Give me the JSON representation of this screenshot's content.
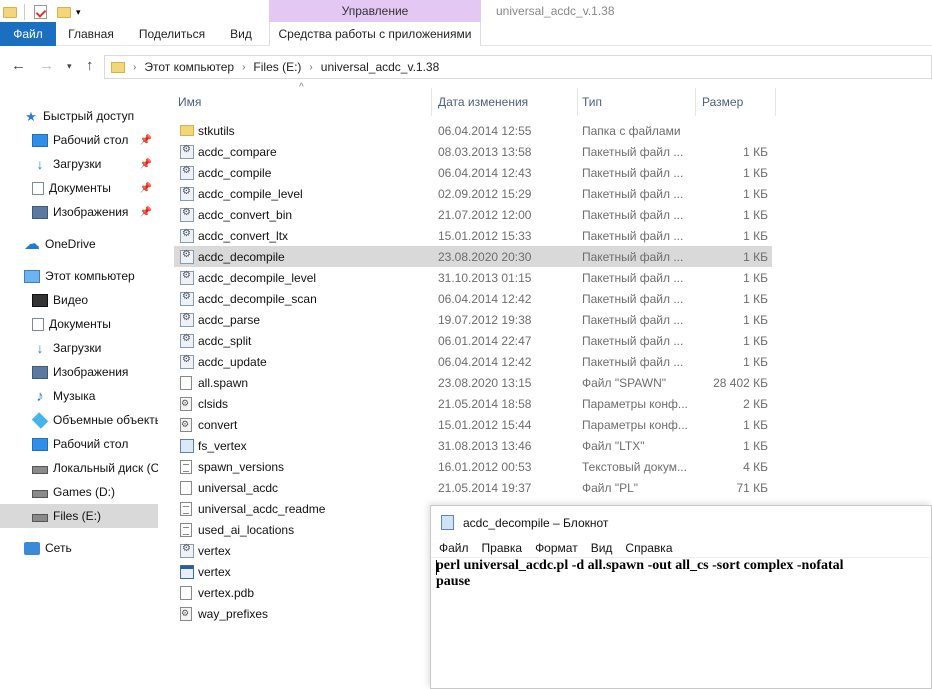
{
  "window": {
    "title": "universal_acdc_v.1.38",
    "context_tab": "Управление"
  },
  "ribbon": {
    "tabs": [
      "Файл",
      "Главная",
      "Поделиться",
      "Вид"
    ],
    "context_tools": "Средства работы с приложениями"
  },
  "address": {
    "crumbs": [
      "Этот компьютер",
      "Files (E:)",
      "universal_acdc_v.1.38"
    ]
  },
  "sidebar": {
    "items": [
      {
        "label": "Быстрый доступ",
        "icon": "star-icon"
      },
      {
        "label": "Рабочий стол",
        "icon": "desktop-icon",
        "pinned": true
      },
      {
        "label": "Загрузки",
        "icon": "download-icon",
        "pinned": true
      },
      {
        "label": "Документы",
        "icon": "documents-icon",
        "pinned": true
      },
      {
        "label": "Изображения",
        "icon": "pictures-icon",
        "pinned": true
      },
      {
        "label": "OneDrive",
        "icon": "cloud-icon"
      },
      {
        "label": "Этот компьютер",
        "icon": "computer-icon"
      },
      {
        "label": "Видео",
        "icon": "video-icon"
      },
      {
        "label": "Документы",
        "icon": "documents-icon"
      },
      {
        "label": "Загрузки",
        "icon": "download-icon"
      },
      {
        "label": "Изображения",
        "icon": "pictures-icon"
      },
      {
        "label": "Музыка",
        "icon": "music-icon"
      },
      {
        "label": "Объемные объекты",
        "icon": "3d-objects-icon"
      },
      {
        "label": "Рабочий стол",
        "icon": "desktop-icon"
      },
      {
        "label": "Локальный диск (C:)",
        "icon": "drive-icon"
      },
      {
        "label": "Games (D:)",
        "icon": "drive-icon"
      },
      {
        "label": "Files (E:)",
        "icon": "drive-icon",
        "selected": true
      },
      {
        "label": "Сеть",
        "icon": "network-icon"
      }
    ]
  },
  "columns": {
    "name": "Имя",
    "date": "Дата изменения",
    "type": "Тип",
    "size": "Размер"
  },
  "files": [
    {
      "name": "stkutils",
      "date": "06.04.2014 12:55",
      "type": "Папка с файлами",
      "size": "",
      "icon": "folder"
    },
    {
      "name": "acdc_compare",
      "date": "08.03.2013 13:58",
      "type": "Пакетный файл ...",
      "size": "1 КБ",
      "icon": "bat"
    },
    {
      "name": "acdc_compile",
      "date": "06.04.2014 12:43",
      "type": "Пакетный файл ...",
      "size": "1 КБ",
      "icon": "bat"
    },
    {
      "name": "acdc_compile_level",
      "date": "02.09.2012 15:29",
      "type": "Пакетный файл ...",
      "size": "1 КБ",
      "icon": "bat"
    },
    {
      "name": "acdc_convert_bin",
      "date": "21.07.2012 12:00",
      "type": "Пакетный файл ...",
      "size": "1 КБ",
      "icon": "bat"
    },
    {
      "name": "acdc_convert_ltx",
      "date": "15.01.2012 15:33",
      "type": "Пакетный файл ...",
      "size": "1 КБ",
      "icon": "bat"
    },
    {
      "name": "acdc_decompile",
      "date": "23.08.2020 20:30",
      "type": "Пакетный файл ...",
      "size": "1 КБ",
      "icon": "bat",
      "selected": true
    },
    {
      "name": "acdc_decompile_level",
      "date": "31.10.2013 01:15",
      "type": "Пакетный файл ...",
      "size": "1 КБ",
      "icon": "bat"
    },
    {
      "name": "acdc_decompile_scan",
      "date": "06.04.2014 12:42",
      "type": "Пакетный файл ...",
      "size": "1 КБ",
      "icon": "bat"
    },
    {
      "name": "acdc_parse",
      "date": "19.07.2012 19:38",
      "type": "Пакетный файл ...",
      "size": "1 КБ",
      "icon": "bat"
    },
    {
      "name": "acdc_split",
      "date": "06.01.2014 22:47",
      "type": "Пакетный файл ...",
      "size": "1 КБ",
      "icon": "bat"
    },
    {
      "name": "acdc_update",
      "date": "06.04.2014 12:42",
      "type": "Пакетный файл ...",
      "size": "1 КБ",
      "icon": "bat"
    },
    {
      "name": "all.spawn",
      "date": "23.08.2020 13:15",
      "type": "Файл \"SPAWN\"",
      "size": "28 402 КБ",
      "icon": "doc"
    },
    {
      "name": "clsids",
      "date": "21.05.2014 18:58",
      "type": "Параметры конф...",
      "size": "2 КБ",
      "icon": "cfg"
    },
    {
      "name": "convert",
      "date": "15.01.2012 15:44",
      "type": "Параметры конф...",
      "size": "1 КБ",
      "icon": "cfg"
    },
    {
      "name": "fs_vertex",
      "date": "31.08.2013 13:46",
      "type": "Файл \"LTX\"",
      "size": "1 КБ",
      "icon": "ltx"
    },
    {
      "name": "spawn_versions",
      "date": "16.01.2012 00:53",
      "type": "Текстовый докум...",
      "size": "4 КБ",
      "icon": "txt"
    },
    {
      "name": "universal_acdc",
      "date": "21.05.2014 19:37",
      "type": "Файл \"PL\"",
      "size": "71 КБ",
      "icon": "doc"
    },
    {
      "name": "universal_acdc_readme",
      "date": "",
      "type": "",
      "size": "",
      "icon": "txt"
    },
    {
      "name": "used_ai_locations",
      "date": "",
      "type": "",
      "size": "",
      "icon": "txt"
    },
    {
      "name": "vertex",
      "date": "",
      "type": "",
      "size": "",
      "icon": "bat"
    },
    {
      "name": "vertex",
      "date": "",
      "type": "",
      "size": "",
      "icon": "exe"
    },
    {
      "name": "vertex.pdb",
      "date": "",
      "type": "",
      "size": "",
      "icon": "doc"
    },
    {
      "name": "way_prefixes",
      "date": "",
      "type": "",
      "size": "",
      "icon": "cfg"
    }
  ],
  "notepad": {
    "title": "acdc_decompile – Блокнот",
    "menu": [
      "Файл",
      "Правка",
      "Формат",
      "Вид",
      "Справка"
    ],
    "lines": [
      "perl universal_acdc.pl -d all.spawn -out all_cs -sort complex -nofatal",
      "pause"
    ]
  }
}
